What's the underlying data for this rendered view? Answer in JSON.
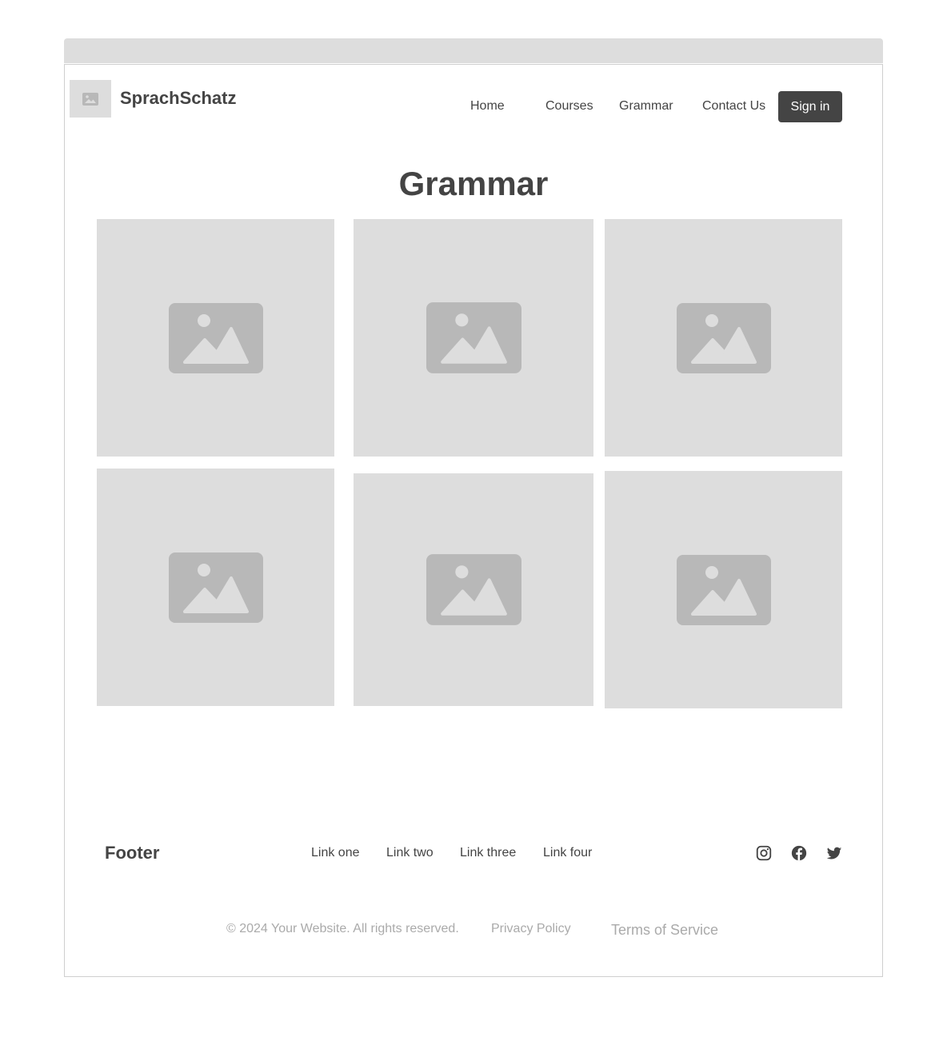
{
  "header": {
    "brand": "SprachSchatz",
    "logo_icon": "image-placeholder-icon",
    "nav": [
      {
        "label": "Home"
      },
      {
        "label": "Courses"
      },
      {
        "label": "Grammar"
      },
      {
        "label": "Contact Us"
      }
    ],
    "signin_label": "Sign in"
  },
  "main": {
    "title": "Grammar",
    "cards": [
      {
        "icon": "image-placeholder-icon"
      },
      {
        "icon": "image-placeholder-icon"
      },
      {
        "icon": "image-placeholder-icon"
      },
      {
        "icon": "image-placeholder-icon"
      },
      {
        "icon": "image-placeholder-icon"
      },
      {
        "icon": "image-placeholder-icon"
      }
    ]
  },
  "footer": {
    "title": "Footer",
    "links": [
      {
        "label": "Link one"
      },
      {
        "label": "Link two"
      },
      {
        "label": "Link three"
      },
      {
        "label": "Link four"
      }
    ],
    "social": [
      "instagram-icon",
      "facebook-icon",
      "twitter-icon"
    ],
    "copyright": "© 2024 Your Website. All rights reserved.",
    "privacy": "Privacy Policy",
    "terms": "Terms of Service"
  },
  "colors": {
    "placeholder_bg": "#dddddd",
    "placeholder_icon": "#b8b8b8",
    "text": "#444444",
    "muted": "#aaaaaa",
    "button_bg": "#444444"
  }
}
